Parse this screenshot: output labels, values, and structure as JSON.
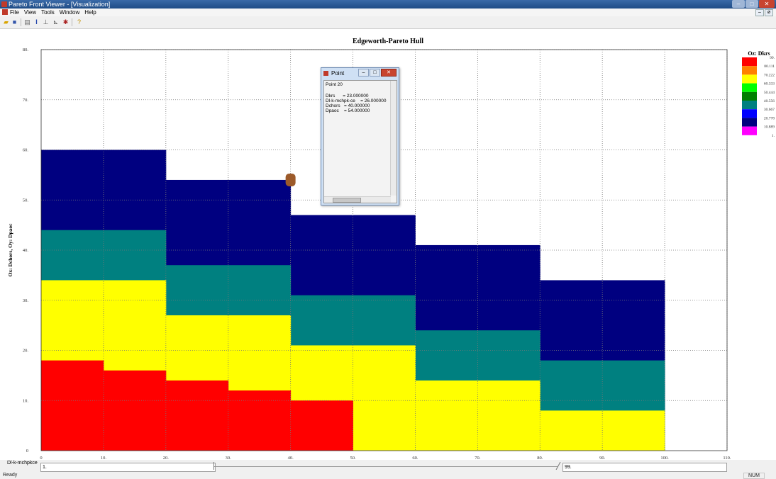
{
  "window": {
    "title": "Pareto Front Viewer - [Visualization]",
    "controls": {
      "minimize": "–",
      "maximize": "□",
      "close": "✕"
    }
  },
  "menu": {
    "items": [
      "File",
      "View",
      "Tools",
      "Window",
      "Help"
    ],
    "mdi_controls": [
      "–",
      "ø"
    ]
  },
  "toolbar": {
    "icons": [
      "open-folder-icon",
      "save-icon",
      "print-icon",
      "text-cursor-icon",
      "axis-icon",
      "axes-icon",
      "wizard-icon",
      "help-icon"
    ]
  },
  "chart_data": {
    "type": "area",
    "title": "Edgeworth-Pareto Hull",
    "ylabel": "Ox: Dchors,   Oy: Dpaoc",
    "xlim": [
      0,
      110
    ],
    "ylim": [
      0,
      80
    ],
    "x_ticks": [
      "0",
      "10.",
      "20.",
      "30.",
      "40.",
      "50.",
      "60.",
      "70.",
      "80.",
      "90.",
      "100.",
      "110."
    ],
    "y_ticks": [
      "0",
      "10.",
      "20.",
      "30.",
      "40.",
      "50.",
      "60.",
      "70.",
      "80."
    ],
    "grid": true,
    "legend": {
      "title": "Oz: Dkrs",
      "placement": "right",
      "labels": [
        "99.",
        "80.111",
        "70.222",
        "60.333",
        "50.444",
        "40.556",
        "30.667",
        "20.778",
        "10.889",
        "1."
      ],
      "colors": [
        "#ff0000",
        "#ff8000",
        "#ffff00",
        "#00ff00",
        "#008000",
        "#008080",
        "#0000ff",
        "#000080",
        "#ff00ff"
      ]
    },
    "layers": [
      {
        "name": "navy",
        "color": "#000080",
        "steps": [
          [
            0,
            10,
            60
          ],
          [
            10,
            20,
            60
          ],
          [
            20,
            30,
            54
          ],
          [
            30,
            40,
            54
          ],
          [
            40,
            50,
            47
          ],
          [
            50,
            60,
            47
          ],
          [
            60,
            70,
            41
          ],
          [
            70,
            80,
            41
          ],
          [
            80,
            90,
            34
          ],
          [
            90,
            100,
            34
          ]
        ]
      },
      {
        "name": "teal",
        "color": "#008080",
        "steps": [
          [
            0,
            10,
            44
          ],
          [
            10,
            20,
            44
          ],
          [
            20,
            30,
            37
          ],
          [
            30,
            40,
            37
          ],
          [
            40,
            50,
            31
          ],
          [
            50,
            60,
            31
          ],
          [
            60,
            70,
            24
          ],
          [
            70,
            80,
            24
          ],
          [
            80,
            90,
            18
          ],
          [
            90,
            100,
            18
          ]
        ]
      },
      {
        "name": "yellow",
        "color": "#ffff00",
        "steps": [
          [
            0,
            10,
            34
          ],
          [
            10,
            20,
            34
          ],
          [
            20,
            30,
            27
          ],
          [
            30,
            40,
            27
          ],
          [
            40,
            50,
            21
          ],
          [
            50,
            60,
            21
          ],
          [
            60,
            70,
            14
          ],
          [
            70,
            80,
            14
          ],
          [
            80,
            90,
            8
          ],
          [
            90,
            100,
            8
          ]
        ]
      },
      {
        "name": "red",
        "color": "#ff0000",
        "steps": [
          [
            0,
            10,
            18
          ],
          [
            10,
            20,
            16
          ],
          [
            20,
            30,
            14
          ],
          [
            30,
            35,
            12
          ],
          [
            35,
            40,
            12
          ],
          [
            40,
            50,
            10
          ]
        ]
      }
    ],
    "marker": {
      "x": 40,
      "y": 54,
      "color": "#9c5a2a"
    }
  },
  "point_popup": {
    "title": "Point",
    "lines": [
      "Point 20",
      "",
      "Dkrs      = 23.000000",
      "Dl-k-mchpk-ce    = 26.000000",
      "Dchors   = 40.000000",
      "Dpaoc    = 54.000000"
    ]
  },
  "slider": {
    "label": "Dl-k-mchpkce",
    "min_value": "1.",
    "max_value": "99."
  },
  "status": {
    "text": "Ready",
    "num": "NUM"
  }
}
